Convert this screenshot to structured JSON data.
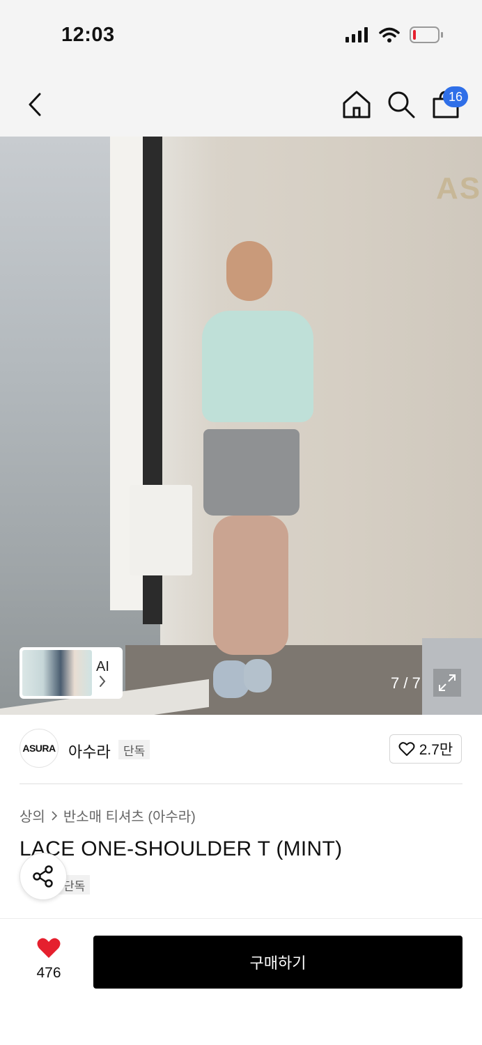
{
  "status_bar": {
    "time": "12:03",
    "icons": [
      "signal-icon",
      "wifi-icon",
      "battery-low-icon"
    ]
  },
  "header": {
    "icons": [
      "back-icon",
      "home-icon",
      "search-icon",
      "shopping-bag-icon"
    ],
    "cart_count": "16"
  },
  "hero": {
    "wall_logo": "ASUR",
    "ai_label": "AI",
    "counter": "7 / 7"
  },
  "brand": {
    "logo_text": "ASURA",
    "name": "아수라",
    "tag": "단독",
    "like_count": "2.7만"
  },
  "product": {
    "breadcrumb": [
      "상의",
      "반소매 티셔츠 (아수라)"
    ],
    "title": "LACE ONE-SHOULDER T (MINT)",
    "tag": "단독"
  },
  "bottom_bar": {
    "heart_count": "476",
    "buy_label": "구매하기"
  },
  "colors": {
    "accent_blue": "#2f6fe8",
    "heart_red": "#e5202e",
    "buy_button": "#000000"
  }
}
